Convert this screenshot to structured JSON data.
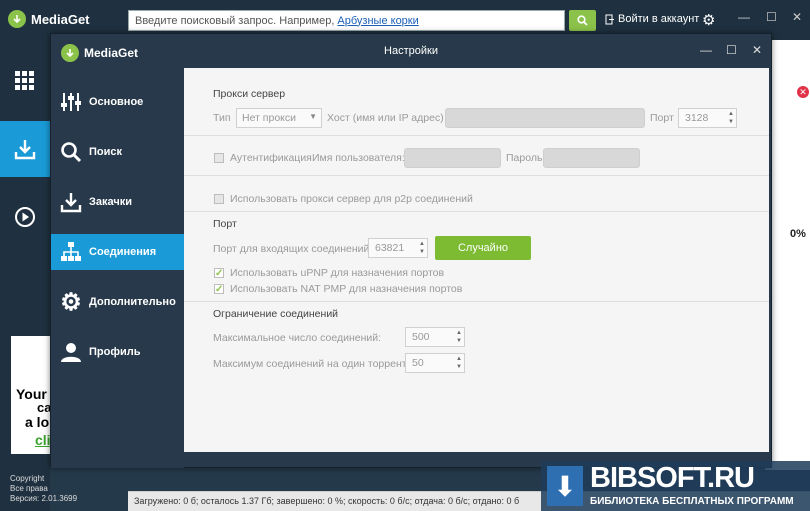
{
  "app": {
    "name": "MediaGet",
    "search_placeholder": "Введите поисковый запрос. Например,",
    "search_example": "Арбузные корки",
    "login_label": "Войти в аккаунт",
    "copyright_line1": "Copyright",
    "copyright_line2": "Все права",
    "version": "Версия: 2.01.3699",
    "percent": "0%",
    "ad_lines": [
      "Your",
      "ca",
      "a lo",
      "cli"
    ],
    "status": "Загружено: 0 б; осталось 1.37 Гб; завершено: 0 %; скорость: 0 б/с; отдача: 0 б/с; отдано: 0 б"
  },
  "dialog": {
    "logo": "MediaGet",
    "title": "Настройки",
    "nav": [
      {
        "label": "Основное",
        "icon": "sliders-icon"
      },
      {
        "label": "Поиск",
        "icon": "search-icon"
      },
      {
        "label": "Закачки",
        "icon": "download-icon"
      },
      {
        "label": "Соединения",
        "icon": "network-icon"
      },
      {
        "label": "Дополнительно",
        "icon": "gear-icon"
      },
      {
        "label": "Профиль",
        "icon": "user-icon"
      }
    ],
    "active_nav": "Соединения",
    "proxy": {
      "header": "Прокси сервер",
      "type_label": "Тип",
      "type_value": "Нет прокси",
      "host_label": "Хост (имя или IP адрес)",
      "host_value": "",
      "port_label": "Порт",
      "port_value": "3128",
      "auth_label": "Аутентификация",
      "user_label": "Имя пользователя:",
      "user_value": "",
      "password_label": "Пароль",
      "password_value": "",
      "p2p_label": "Использовать прокси сервер для p2p соединений",
      "auth_checked": false,
      "p2p_checked": false
    },
    "port": {
      "header": "Порт",
      "incoming_label": "Порт для входящих соединений:",
      "incoming_value": "63821",
      "random_button": "Случайно",
      "upnp_label": "Использовать uPNP для назначения портов",
      "upnp_checked": true,
      "natpmp_label": "Использовать NAT PMP для назначения портов",
      "natpmp_checked": true
    },
    "limits": {
      "header": "Ограничение соединений",
      "max_label": "Максимальное число соединений:",
      "max_value": "500",
      "per_torrent_label": "Максимум соединений на один торрент:",
      "per_torrent_value": "50"
    }
  },
  "watermark": {
    "big": "BIBSOFT.RU",
    "small": "БИБЛИОТЕКА БЕСПЛАТНЫХ ПРОГРАММ"
  },
  "colors": {
    "accent": "#1a9bd7",
    "green": "#8bc34a",
    "dark": "#27394a"
  }
}
